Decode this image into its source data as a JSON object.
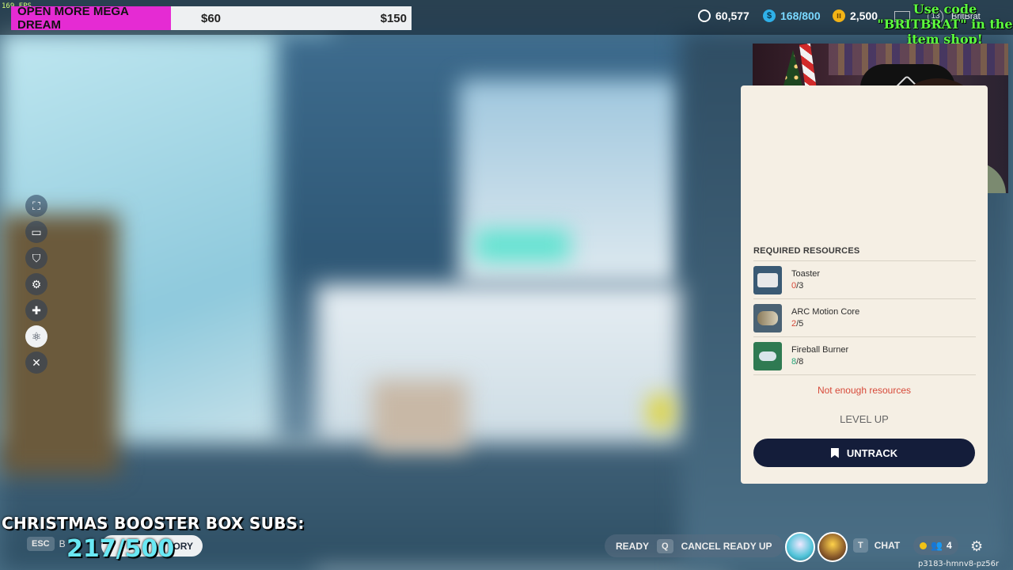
{
  "fps": "169 FPS",
  "dream_goal": {
    "label": "OPEN MORE MEGA DREAM",
    "current": "$60",
    "target": "$150"
  },
  "currencies": [
    {
      "icon": "credits-icon",
      "value": "60,577"
    },
    {
      "icon": "token-icon",
      "value": "168/800"
    },
    {
      "icon": "coin-icon",
      "value": "2,500"
    }
  ],
  "promo": "Use code \"BRITBRAT\" in the item shop!",
  "user": {
    "level": "13",
    "name": "BritBrat"
  },
  "left_tools": [
    "map-icon",
    "workbench-icon",
    "shield-icon",
    "gear-tool-icon",
    "plus-icon",
    "atom-icon",
    "tools-icon"
  ],
  "panel": {
    "required_title": "REQUIRED RESOURCES",
    "resources": [
      {
        "name": "Toaster",
        "have": "0",
        "need": "/3"
      },
      {
        "name": "ARC Motion Core",
        "have": "2",
        "need": "/5"
      },
      {
        "name": "Fireball Burner",
        "have": "8",
        "need": "/8"
      }
    ],
    "warning": "Not enough resources",
    "level_up": "LEVEL UP",
    "untrack": "UNTRACK"
  },
  "overlay": {
    "subs_title": "CHRISTMAS BOOSTER BOX SUBS:",
    "subs_count": "217/500"
  },
  "bottom": {
    "esc_key": "ESC",
    "esc_label": "B",
    "inventory": "ORY",
    "ready": "READY",
    "cancel_key": "Q",
    "cancel": "CANCEL READY UP",
    "chat_key": "T",
    "chat": "CHAT",
    "party_count": "4",
    "session": "p3183-hmnv8-pz56r"
  },
  "colors": {
    "accent": "#e52bd3",
    "button": "#141d3a",
    "warning": "#d74a3a",
    "ok": "#28a57a"
  }
}
